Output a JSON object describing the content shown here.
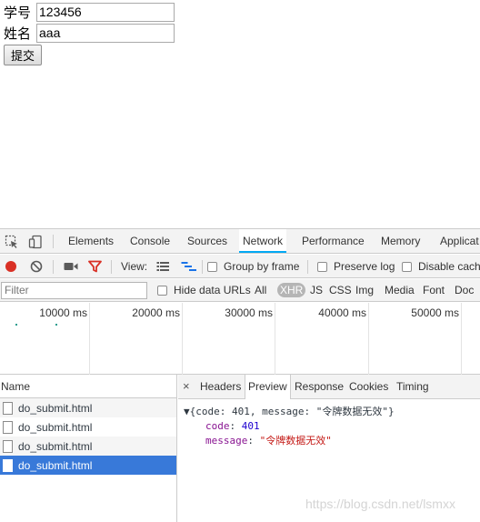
{
  "form": {
    "student_id_label": "学号",
    "student_id_value": "123456",
    "name_label": "姓名",
    "name_value": "aaa",
    "submit_label": "提交"
  },
  "devtools": {
    "tabs": [
      "Elements",
      "Console",
      "Sources",
      "Network",
      "Performance",
      "Memory",
      "Applicat"
    ],
    "active_tab": "Network",
    "toolbar": {
      "view_label": "View:",
      "group_by_frame": "Group by frame",
      "preserve_log": "Preserve log",
      "disable_cache": "Disable cache"
    },
    "filter": {
      "placeholder": "Filter",
      "hide_data_urls": "Hide data URLs",
      "types": [
        "All",
        "XHR",
        "JS",
        "CSS",
        "Img",
        "Media",
        "Font",
        "Doc"
      ],
      "active_type": "XHR"
    },
    "timeline": {
      "ticks": [
        "10000 ms",
        "20000 ms",
        "30000 ms",
        "40000 ms",
        "50000 ms"
      ]
    },
    "request_list": {
      "header": "Name",
      "rows": [
        "do_submit.html",
        "do_submit.html",
        "do_submit.html",
        "do_submit.html"
      ],
      "selected_index": 3
    },
    "detail": {
      "close": "×",
      "tabs": [
        "Headers",
        "Preview",
        "Response",
        "Cookies",
        "Timing"
      ],
      "active_tab": "Preview",
      "preview": {
        "summary": "▼{code: 401, message: \"令牌数据无效\"}",
        "code_key": "code",
        "code_value": "401",
        "message_key": "message",
        "message_value": "\"令牌数据无效\""
      }
    }
  },
  "watermark": "https://blog.csdn.net/lsmxx",
  "colors": {
    "active_tab_underline": "#03a9f4",
    "record_red": "#d93025",
    "filter_red": "#d93025",
    "selected_row": "#3879d9"
  }
}
